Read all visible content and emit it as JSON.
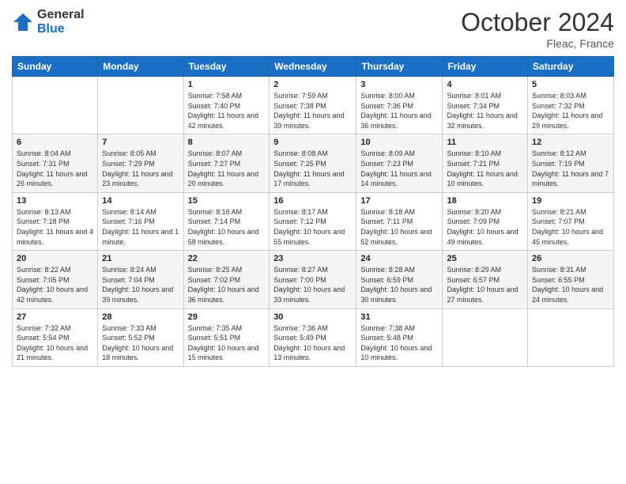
{
  "logo": {
    "general": "General",
    "blue": "Blue"
  },
  "title": "October 2024",
  "location": "Fleac, France",
  "days_of_week": [
    "Sunday",
    "Monday",
    "Tuesday",
    "Wednesday",
    "Thursday",
    "Friday",
    "Saturday"
  ],
  "weeks": [
    [
      {
        "day": "",
        "sunrise": "",
        "sunset": "",
        "daylight": ""
      },
      {
        "day": "",
        "sunrise": "",
        "sunset": "",
        "daylight": ""
      },
      {
        "day": "1",
        "sunrise": "Sunrise: 7:58 AM",
        "sunset": "Sunset: 7:40 PM",
        "daylight": "Daylight: 11 hours and 42 minutes."
      },
      {
        "day": "2",
        "sunrise": "Sunrise: 7:59 AM",
        "sunset": "Sunset: 7:38 PM",
        "daylight": "Daylight: 11 hours and 39 minutes."
      },
      {
        "day": "3",
        "sunrise": "Sunrise: 8:00 AM",
        "sunset": "Sunset: 7:36 PM",
        "daylight": "Daylight: 11 hours and 36 minutes."
      },
      {
        "day": "4",
        "sunrise": "Sunrise: 8:01 AM",
        "sunset": "Sunset: 7:34 PM",
        "daylight": "Daylight: 11 hours and 32 minutes."
      },
      {
        "day": "5",
        "sunrise": "Sunrise: 8:03 AM",
        "sunset": "Sunset: 7:32 PM",
        "daylight": "Daylight: 11 hours and 29 minutes."
      }
    ],
    [
      {
        "day": "6",
        "sunrise": "Sunrise: 8:04 AM",
        "sunset": "Sunset: 7:31 PM",
        "daylight": "Daylight: 11 hours and 26 minutes."
      },
      {
        "day": "7",
        "sunrise": "Sunrise: 8:05 AM",
        "sunset": "Sunset: 7:29 PM",
        "daylight": "Daylight: 11 hours and 23 minutes."
      },
      {
        "day": "8",
        "sunrise": "Sunrise: 8:07 AM",
        "sunset": "Sunset: 7:27 PM",
        "daylight": "Daylight: 11 hours and 20 minutes."
      },
      {
        "day": "9",
        "sunrise": "Sunrise: 8:08 AM",
        "sunset": "Sunset: 7:25 PM",
        "daylight": "Daylight: 11 hours and 17 minutes."
      },
      {
        "day": "10",
        "sunrise": "Sunrise: 8:09 AM",
        "sunset": "Sunset: 7:23 PM",
        "daylight": "Daylight: 11 hours and 14 minutes."
      },
      {
        "day": "11",
        "sunrise": "Sunrise: 8:10 AM",
        "sunset": "Sunset: 7:21 PM",
        "daylight": "Daylight: 11 hours and 10 minutes."
      },
      {
        "day": "12",
        "sunrise": "Sunrise: 8:12 AM",
        "sunset": "Sunset: 7:19 PM",
        "daylight": "Daylight: 11 hours and 7 minutes."
      }
    ],
    [
      {
        "day": "13",
        "sunrise": "Sunrise: 8:13 AM",
        "sunset": "Sunset: 7:18 PM",
        "daylight": "Daylight: 11 hours and 4 minutes."
      },
      {
        "day": "14",
        "sunrise": "Sunrise: 8:14 AM",
        "sunset": "Sunset: 7:16 PM",
        "daylight": "Daylight: 11 hours and 1 minute."
      },
      {
        "day": "15",
        "sunrise": "Sunrise: 8:16 AM",
        "sunset": "Sunset: 7:14 PM",
        "daylight": "Daylight: 10 hours and 58 minutes."
      },
      {
        "day": "16",
        "sunrise": "Sunrise: 8:17 AM",
        "sunset": "Sunset: 7:12 PM",
        "daylight": "Daylight: 10 hours and 55 minutes."
      },
      {
        "day": "17",
        "sunrise": "Sunrise: 8:18 AM",
        "sunset": "Sunset: 7:11 PM",
        "daylight": "Daylight: 10 hours and 52 minutes."
      },
      {
        "day": "18",
        "sunrise": "Sunrise: 8:20 AM",
        "sunset": "Sunset: 7:09 PM",
        "daylight": "Daylight: 10 hours and 49 minutes."
      },
      {
        "day": "19",
        "sunrise": "Sunrise: 8:21 AM",
        "sunset": "Sunset: 7:07 PM",
        "daylight": "Daylight: 10 hours and 45 minutes."
      }
    ],
    [
      {
        "day": "20",
        "sunrise": "Sunrise: 8:22 AM",
        "sunset": "Sunset: 7:05 PM",
        "daylight": "Daylight: 10 hours and 42 minutes."
      },
      {
        "day": "21",
        "sunrise": "Sunrise: 8:24 AM",
        "sunset": "Sunset: 7:04 PM",
        "daylight": "Daylight: 10 hours and 39 minutes."
      },
      {
        "day": "22",
        "sunrise": "Sunrise: 8:25 AM",
        "sunset": "Sunset: 7:02 PM",
        "daylight": "Daylight: 10 hours and 36 minutes."
      },
      {
        "day": "23",
        "sunrise": "Sunrise: 8:27 AM",
        "sunset": "Sunset: 7:00 PM",
        "daylight": "Daylight: 10 hours and 33 minutes."
      },
      {
        "day": "24",
        "sunrise": "Sunrise: 8:28 AM",
        "sunset": "Sunset: 6:59 PM",
        "daylight": "Daylight: 10 hours and 30 minutes."
      },
      {
        "day": "25",
        "sunrise": "Sunrise: 8:29 AM",
        "sunset": "Sunset: 6:57 PM",
        "daylight": "Daylight: 10 hours and 27 minutes."
      },
      {
        "day": "26",
        "sunrise": "Sunrise: 8:31 AM",
        "sunset": "Sunset: 6:55 PM",
        "daylight": "Daylight: 10 hours and 24 minutes."
      }
    ],
    [
      {
        "day": "27",
        "sunrise": "Sunrise: 7:32 AM",
        "sunset": "Sunset: 5:54 PM",
        "daylight": "Daylight: 10 hours and 21 minutes."
      },
      {
        "day": "28",
        "sunrise": "Sunrise: 7:33 AM",
        "sunset": "Sunset: 5:52 PM",
        "daylight": "Daylight: 10 hours and 18 minutes."
      },
      {
        "day": "29",
        "sunrise": "Sunrise: 7:35 AM",
        "sunset": "Sunset: 5:51 PM",
        "daylight": "Daylight: 10 hours and 15 minutes."
      },
      {
        "day": "30",
        "sunrise": "Sunrise: 7:36 AM",
        "sunset": "Sunset: 5:49 PM",
        "daylight": "Daylight: 10 hours and 13 minutes."
      },
      {
        "day": "31",
        "sunrise": "Sunrise: 7:38 AM",
        "sunset": "Sunset: 5:48 PM",
        "daylight": "Daylight: 10 hours and 10 minutes."
      },
      {
        "day": "",
        "sunrise": "",
        "sunset": "",
        "daylight": ""
      },
      {
        "day": "",
        "sunrise": "",
        "sunset": "",
        "daylight": ""
      }
    ]
  ]
}
